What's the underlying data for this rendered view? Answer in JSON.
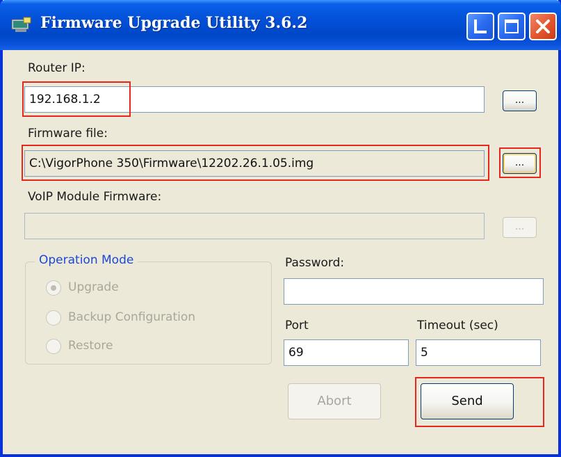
{
  "window": {
    "title": "Firmware Upgrade Utility  3.6.2",
    "controls": {
      "minimize_icon": "minimize-icon",
      "maximize_icon": "maximize-icon",
      "close_icon": "close-icon"
    }
  },
  "router_ip": {
    "label": "Router IP:",
    "value": "192.168.1.2",
    "browse_label": "..."
  },
  "firmware_file": {
    "label": "Firmware file:",
    "value": "C:\\VigorPhone 350\\Firmware\\12202.26.1.05.img",
    "browse_label": "..."
  },
  "voip_firmware": {
    "label": "VoIP Module Firmware:",
    "value": "",
    "browse_label": "..."
  },
  "operation_mode": {
    "title": "Operation Mode",
    "options": [
      {
        "label": "Upgrade",
        "selected": true
      },
      {
        "label": "Backup Configuration",
        "selected": false
      },
      {
        "label": "Restore",
        "selected": false
      }
    ]
  },
  "password": {
    "label": "Password:",
    "value": ""
  },
  "port": {
    "label": "Port",
    "value": "69"
  },
  "timeout": {
    "label": "Timeout (sec)",
    "value": "5"
  },
  "buttons": {
    "abort_label": "Abort",
    "send_label": "Send"
  },
  "colors": {
    "titlebar": "#0350D7",
    "window_bg": "#ECE9D8",
    "highlight": "#E8261C",
    "group_title": "#1A48D8"
  }
}
